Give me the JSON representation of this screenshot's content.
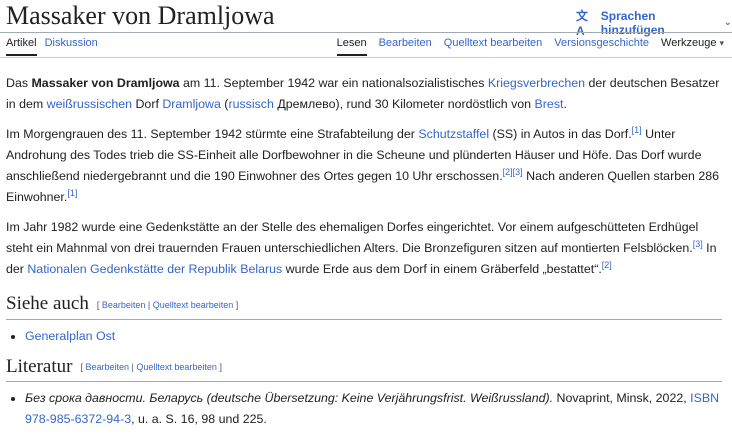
{
  "header": {
    "title": "Massaker von Dramljowa",
    "lang_icon": "translate-icon",
    "lang_label": "Sprachen hinzufügen",
    "lang_chevron": "⌄"
  },
  "tabs_left": [
    {
      "label": "Artikel",
      "selected": true
    },
    {
      "label": "Diskussion",
      "selected": false
    }
  ],
  "tabs_right": [
    {
      "label": "Lesen",
      "selected": true
    },
    {
      "label": "Bearbeiten",
      "selected": false
    },
    {
      "label": "Quelltext bearbeiten",
      "selected": false
    },
    {
      "label": "Versionsgeschichte",
      "selected": false
    },
    {
      "label": "Werkzeuge",
      "selected": false
    }
  ],
  "p1": {
    "t1": "Das ",
    "bold": "Massaker von Dramljowa",
    "t2": " am 11. September 1942 war ein nationalsozialistisches ",
    "l1": "Kriegsverbrechen",
    "t3": " der deutschen Besatzer in dem ",
    "l2": "weißrussischen",
    "t4": " Dorf ",
    "l3": "Dramljowa",
    "t5": " (",
    "l4": "russisch",
    "t6": " Дремлево), rund 30 Kilometer nordöstlich von ",
    "l5": "Brest",
    "t7": "."
  },
  "p2": {
    "t1": "Im Morgengrauen des 11. September 1942 stürmte eine Strafabteilung der ",
    "l1": "Schutzstaffel",
    "t2": " (SS) in Autos in das Dorf.",
    "r1": "[1]",
    "t3": " Unter Androhung des Todes trieb die SS-Einheit alle Dorfbewohner in die Scheune und plünderten Häuser und Höfe. Das Dorf wurde anschließend niedergebrannt und die 190 Einwohner des Ortes gegen 10 Uhr erschossen.",
    "r2": "[2]",
    "r3": "[3]",
    "t4": " Nach anderen Quellen starben 286 Einwohner.",
    "r4": "[1]"
  },
  "p3": {
    "t1": "Im Jahr 1982 wurde eine Gedenkstätte an der Stelle des ehemaligen Dorfes eingerichtet. Vor einem aufgeschütteten Erdhügel steht ein Mahnmal von drei trauernden Frauen unterschiedlichen Alters. Die Bronzefiguren sitzen auf montierten Felsblöcken.",
    "r1": "[3]",
    "t2": " In der ",
    "l1": "Nationalen Gedenkstätte der Republik Belarus",
    "t3": " wurde Erde aus dem Dorf in einem Gräberfeld „bestattet“.",
    "r2": "[2]"
  },
  "section1": {
    "heading": "Siehe auch",
    "edit_open": "[ ",
    "edit1": "Bearbeiten",
    "edit_sep": " | ",
    "edit2": "Quelltext bearbeiten",
    "edit_close": " ]",
    "items": [
      "Generalplan Ost"
    ]
  },
  "section2": {
    "heading": "Literatur",
    "edit_open": "[ ",
    "edit1": "Bearbeiten",
    "edit_sep": " | ",
    "edit2": "Quelltext bearbeiten",
    "edit_close": " ]",
    "item": {
      "italic": "Без срока давности. Беларусь (deutsche Übersetzung: Keine Verjährungsfrist. Weißrussland).",
      "t1": " Novaprint, Minsk, 2022, ",
      "l1": "ISBN 978-985-6372-94-3",
      "t2": ", u. a. S. 16, 98 und 225."
    }
  }
}
